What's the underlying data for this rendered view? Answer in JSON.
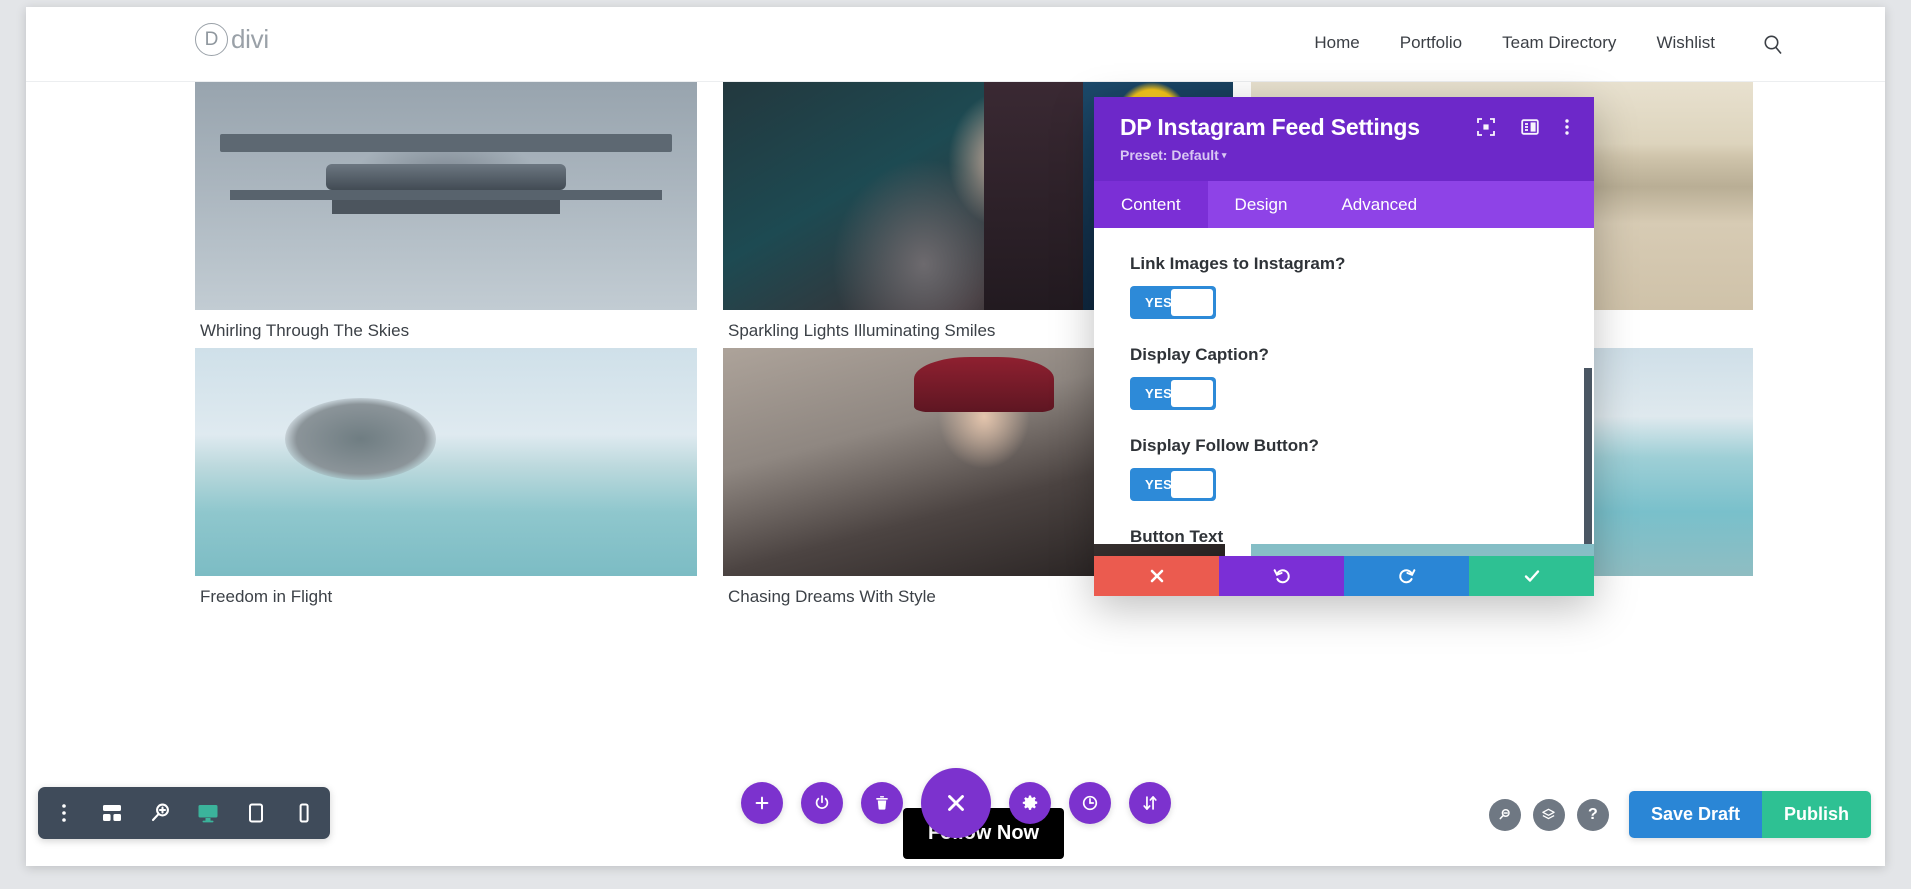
{
  "site": {
    "logo_letter": "D",
    "logo_text": "divi",
    "nav": [
      {
        "label": "Home"
      },
      {
        "label": "Portfolio"
      },
      {
        "label": "Team Directory"
      },
      {
        "label": "Wishlist"
      }
    ],
    "search_icon": "search-icon"
  },
  "gallery": {
    "items": [
      {
        "caption": "Whirling Through The Skies",
        "photo": "osprey-aircraft"
      },
      {
        "caption": "Sparkling Lights Illuminating Smiles",
        "photo": "woman-portrait"
      },
      {
        "caption": "",
        "photo": "yellow-light"
      },
      {
        "caption": "",
        "photo": "red-sports-car"
      },
      {
        "caption": "Freedom in Flight",
        "photo": "bird-in-flight"
      },
      {
        "caption": "Chasing Dreams With Style",
        "photo": "woman-beanie"
      },
      {
        "caption": "",
        "photo": "pelican-on-post"
      }
    ],
    "follow_button_label": "Follow Now"
  },
  "settings_modal": {
    "title": "DP Instagram Feed Settings",
    "preset_label": "Preset: Default",
    "preset_caret": "▾",
    "header_icons": [
      {
        "name": "fullscreen-icon"
      },
      {
        "name": "layout-toggle-icon"
      },
      {
        "name": "more-options-icon"
      }
    ],
    "tabs": [
      {
        "label": "Content",
        "active": true
      },
      {
        "label": "Design",
        "active": false
      },
      {
        "label": "Advanced",
        "active": false
      }
    ],
    "fields": [
      {
        "label": "Link Images to Instagram?",
        "type": "toggle",
        "value": "YES"
      },
      {
        "label": "Display Caption?",
        "type": "toggle",
        "value": "YES"
      },
      {
        "label": "Display Follow Button?",
        "type": "toggle",
        "value": "YES"
      },
      {
        "label": "Button Text",
        "type": "text",
        "value": "",
        "placeholder": "Follow Now"
      }
    ],
    "footer": [
      {
        "name": "cancel-button",
        "icon": "close-icon"
      },
      {
        "name": "undo-button",
        "icon": "undo-icon"
      },
      {
        "name": "redo-button",
        "icon": "redo-icon"
      },
      {
        "name": "save-button",
        "icon": "check-icon"
      }
    ],
    "colors": {
      "header": "#6d28c9",
      "tabs": "#8e43e7",
      "tab_active": "#7b2fd6",
      "toggle_on": "#2d8ad8",
      "cancel": "#eb5b4f",
      "undo": "#7b2fd6",
      "redo": "#2a86d6",
      "save": "#2ec193"
    }
  },
  "builder_bar": {
    "left_tools": [
      {
        "name": "more-vertical-icon"
      },
      {
        "name": "wireframe-view-icon"
      },
      {
        "name": "zoom-out-view-icon"
      },
      {
        "name": "desktop-view-icon",
        "active": true
      },
      {
        "name": "tablet-view-icon"
      },
      {
        "name": "phone-view-icon"
      }
    ],
    "center_tools": [
      {
        "name": "add-section-button",
        "icon": "plus-icon"
      },
      {
        "name": "page-settings-button",
        "icon": "power-icon"
      },
      {
        "name": "delete-button",
        "icon": "trash-icon"
      },
      {
        "name": "close-builder-button",
        "icon": "close-icon",
        "big": true
      },
      {
        "name": "settings-button",
        "icon": "gear-icon"
      },
      {
        "name": "history-button",
        "icon": "clock-icon"
      },
      {
        "name": "portability-button",
        "icon": "updown-arrows-icon"
      }
    ],
    "right_tools": [
      {
        "name": "search-button",
        "icon": "search-icon"
      },
      {
        "name": "layers-button",
        "icon": "layers-icon"
      },
      {
        "name": "help-button",
        "icon": "question-icon"
      }
    ],
    "save_draft_label": "Save Draft",
    "publish_label": "Publish",
    "colors": {
      "toolbar": "#3f4b5a",
      "round": "#7c32ce",
      "grey": "#6f7883",
      "save_draft": "#2a86d6",
      "publish": "#2ec193"
    }
  }
}
